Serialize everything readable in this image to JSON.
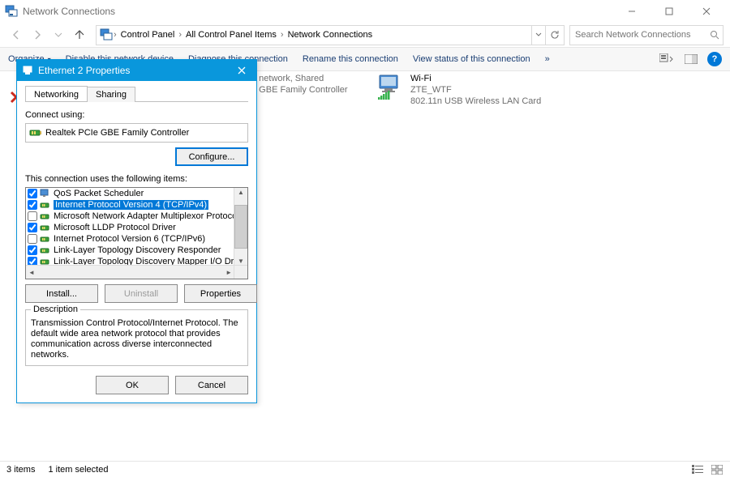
{
  "window": {
    "title": "Network Connections"
  },
  "breadcrumb": {
    "items": [
      "Control Panel",
      "All Control Panel Items",
      "Network Connections"
    ]
  },
  "search": {
    "placeholder": "Search Network Connections"
  },
  "toolbar": {
    "organize": "Organize",
    "disable": "Disable this network device",
    "diagnose": "Diagnose this connection",
    "rename": "Rename this connection",
    "viewstatus": "View status of this connection",
    "chevrons": "»"
  },
  "connections": {
    "c1": {
      "line1b": "d network, Shared",
      "line2b": "e GBE Family Controller"
    },
    "wifi": {
      "name": "Wi-Fi",
      "ssid": "ZTE_WTF",
      "adapter": "802.11n USB Wireless LAN Card"
    }
  },
  "dialog": {
    "title": "Ethernet 2 Properties",
    "tabs": {
      "networking": "Networking",
      "sharing": "Sharing"
    },
    "connect_using": "Connect using:",
    "adapter": "Realtek PCIe GBE Family Controller",
    "configure": "Configure...",
    "items_label": "This connection uses the following items:",
    "items": [
      {
        "checked": true,
        "label": "QoS Packet Scheduler",
        "sel": false,
        "kind": "svc"
      },
      {
        "checked": true,
        "label": "Internet Protocol Version 4 (TCP/IPv4)",
        "sel": true,
        "kind": "proto"
      },
      {
        "checked": false,
        "label": "Microsoft Network Adapter Multiplexor Protocol",
        "sel": false,
        "kind": "proto"
      },
      {
        "checked": true,
        "label": "Microsoft LLDP Protocol Driver",
        "sel": false,
        "kind": "proto"
      },
      {
        "checked": false,
        "label": "Internet Protocol Version 6 (TCP/IPv6)",
        "sel": false,
        "kind": "proto"
      },
      {
        "checked": true,
        "label": "Link-Layer Topology Discovery Responder",
        "sel": false,
        "kind": "proto"
      },
      {
        "checked": true,
        "label": "Link-Layer Topology Discovery Mapper I/O Driver",
        "sel": false,
        "kind": "proto"
      }
    ],
    "install": "Install...",
    "uninstall": "Uninstall",
    "properties": "Properties",
    "desc_legend": "Description",
    "desc_text": "Transmission Control Protocol/Internet Protocol. The default wide area network protocol that provides communication across diverse interconnected networks.",
    "ok": "OK",
    "cancel": "Cancel"
  },
  "status": {
    "items": "3 items",
    "selected": "1 item selected"
  }
}
